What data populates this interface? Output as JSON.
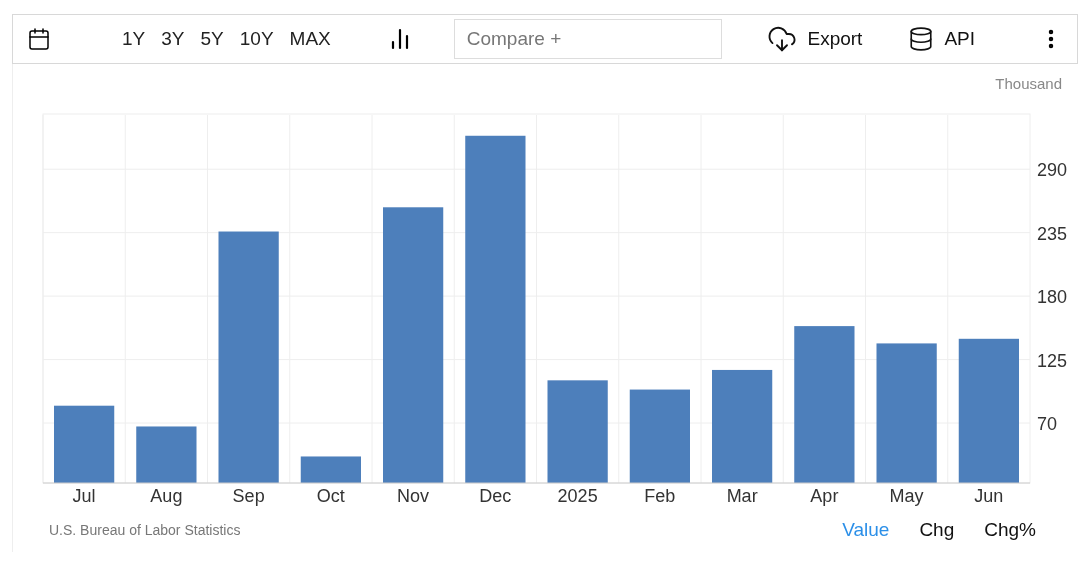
{
  "toolbar": {
    "ranges": [
      {
        "label": "1Y",
        "selected": false
      },
      {
        "label": "3Y",
        "selected": false
      },
      {
        "label": "5Y",
        "selected": false
      },
      {
        "label": "10Y",
        "selected": false
      },
      {
        "label": "MAX",
        "selected": false
      }
    ],
    "compare": {
      "placeholder": "Compare +"
    },
    "actions": [
      {
        "label": "Export",
        "kind": "export"
      },
      {
        "label": "API",
        "kind": "api"
      }
    ]
  },
  "chart": {
    "chart_data": {
      "type": "bar",
      "ylabel": "Thousand",
      "categories": [
        "Jul",
        "Aug",
        "Sep",
        "Oct",
        "Nov",
        "Dec",
        "2025",
        "Feb",
        "Mar",
        "Apr",
        "May",
        "Jun"
      ],
      "grid": true,
      "series": [
        {
          "color": "#4d7fbb",
          "values": [
            85,
            67,
            236,
            41,
            257,
            319,
            107,
            99,
            116,
            154,
            139,
            143
          ]
        }
      ],
      "ylim": [
        18,
        337
      ],
      "yticks": [
        70,
        125,
        180,
        235,
        290
      ]
    }
  },
  "footer": {
    "source": "U.S. Bureau of Labor Statistics",
    "views": [
      {
        "label": "Value",
        "selected": true
      },
      {
        "label": "Chg",
        "selected": false
      },
      {
        "label": "Chg%",
        "selected": false
      }
    ]
  }
}
